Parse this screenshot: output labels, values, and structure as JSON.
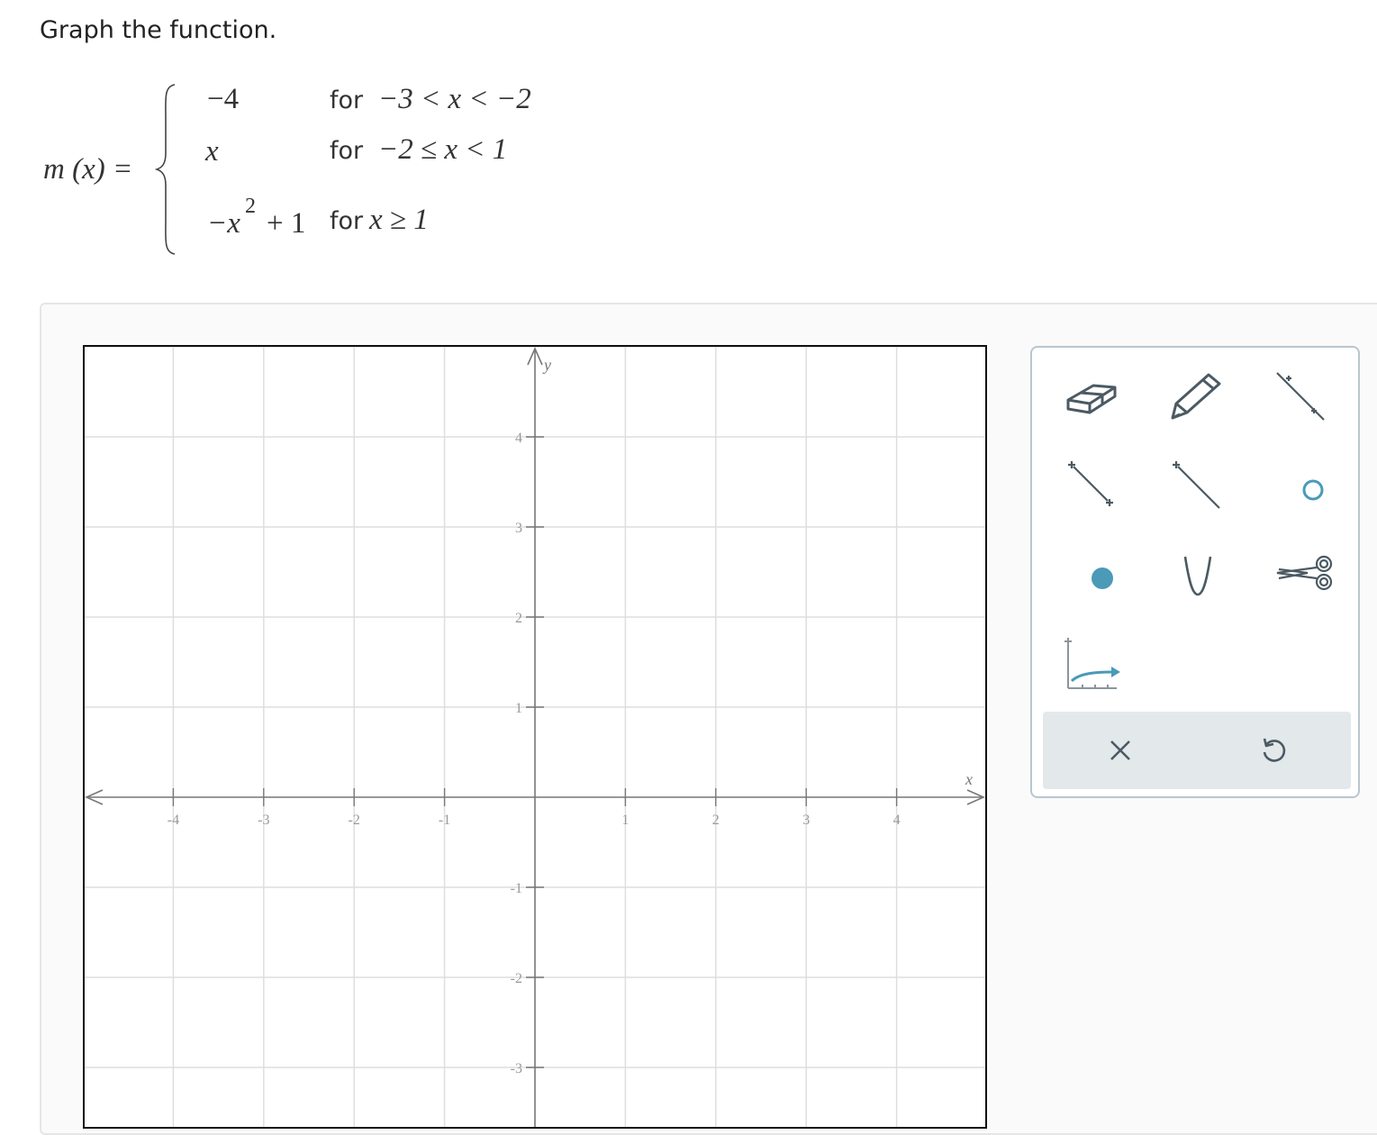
{
  "prompt": "Graph the function.",
  "function": {
    "lhs": "m (x) =",
    "pieces": [
      {
        "expr": "−4",
        "cond_word": "for",
        "cond_math": "−3 < x < −2"
      },
      {
        "expr": "x",
        "cond_word": "for",
        "cond_math": "−2 ≤ x < 1"
      },
      {
        "expr_base": "−x",
        "expr_sup": "2",
        "expr_tail": "+ 1",
        "cond_word": "for",
        "cond_math": "x ≥ 1"
      }
    ]
  },
  "graph": {
    "x_axis_label": "x",
    "y_axis_label": "y",
    "x_ticks": [
      "-4",
      "-3",
      "-2",
      "-1",
      "1",
      "2",
      "3",
      "4"
    ],
    "y_ticks": [
      "4",
      "3",
      "2",
      "1",
      "-1",
      "-2",
      "-3"
    ],
    "x_range": [
      -5,
      5
    ],
    "y_range": [
      -3.6,
      5
    ],
    "grid": true
  },
  "toolbox": {
    "tools": [
      {
        "name": "eraser-icon"
      },
      {
        "name": "pencil-icon"
      },
      {
        "name": "line-icon"
      },
      {
        "name": "segment-icon"
      },
      {
        "name": "ray-icon"
      },
      {
        "name": "open-circle-icon"
      },
      {
        "name": "filled-point-icon"
      },
      {
        "name": "parabola-icon"
      },
      {
        "name": "scissors-icon"
      },
      {
        "name": "function-curve-icon"
      }
    ],
    "actions": [
      {
        "name": "clear-icon"
      },
      {
        "name": "undo-icon"
      }
    ],
    "accent_color": "#4a9ab8",
    "icon_color": "#4b5a63"
  }
}
